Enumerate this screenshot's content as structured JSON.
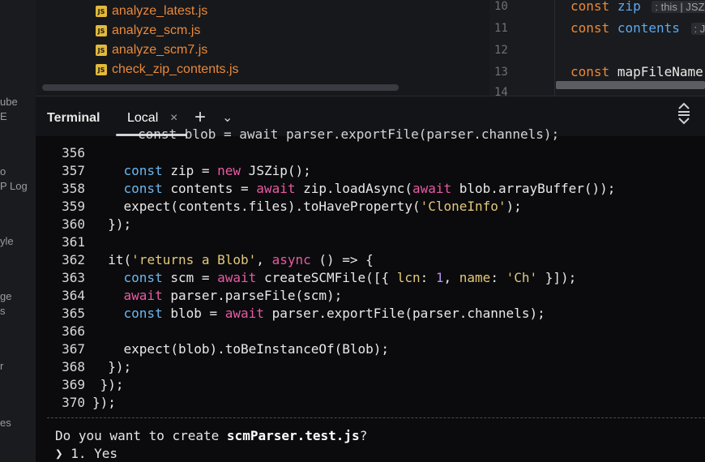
{
  "left_rail": {
    "fragments": [
      "ube",
      "E",
      "o",
      "P Log",
      "yle",
      "ge",
      "s",
      "r",
      "es"
    ]
  },
  "project_files": [
    "analyze_latest.js",
    "analyze_scm.js",
    "analyze_scm7.js",
    "check_zip_contents.js"
  ],
  "editor": {
    "lines": [
      {
        "num": "10",
        "kw": "const",
        "name": "zip",
        "hint": ": this | JSZ"
      },
      {
        "num": "11",
        "kw": "const",
        "name": "contents",
        "hint": ": JS"
      },
      {
        "num": "12",
        "kw": "",
        "name": "",
        "hint": ""
      },
      {
        "num": "13",
        "kw": "const",
        "name": "mapFileName",
        "hint": ""
      },
      {
        "num": "14",
        "kw": "",
        "name": "",
        "hint": ""
      }
    ]
  },
  "terminal_panel": {
    "title": "Terminal",
    "tab_local": "Local",
    "close_glyph": "×",
    "plus_glyph": "+",
    "chevron_glyph": "⌄"
  },
  "terminal": {
    "partial_top_line": "const blob = await parser.exportFile(parser.channels);",
    "lines": [
      {
        "num": "356",
        "segs": []
      },
      {
        "num": "357",
        "segs": [
          [
            "    ",
            "id"
          ],
          [
            "const",
            "dec"
          ],
          [
            " zip = ",
            "id"
          ],
          [
            "new",
            "kw"
          ],
          [
            " JSZip();",
            "id"
          ]
        ]
      },
      {
        "num": "358",
        "segs": [
          [
            "    ",
            "id"
          ],
          [
            "const",
            "dec"
          ],
          [
            " contents = ",
            "id"
          ],
          [
            "await",
            "kw"
          ],
          [
            " zip.loadAsync(",
            "id"
          ],
          [
            "await",
            "kw"
          ],
          [
            " blob.arrayBuffer());",
            "id"
          ]
        ]
      },
      {
        "num": "359",
        "segs": [
          [
            "    expect(contents.files).toHaveProperty(",
            "id"
          ],
          [
            "'CloneInfo'",
            "str"
          ],
          [
            ");",
            "id"
          ]
        ]
      },
      {
        "num": "360",
        "segs": [
          [
            "  });",
            "id"
          ]
        ]
      },
      {
        "num": "361",
        "segs": []
      },
      {
        "num": "362",
        "segs": [
          [
            "  it(",
            "id"
          ],
          [
            "'returns a Blob'",
            "str"
          ],
          [
            ", ",
            "id"
          ],
          [
            "async",
            "kw"
          ],
          [
            " () => {",
            "id"
          ]
        ]
      },
      {
        "num": "363",
        "segs": [
          [
            "    ",
            "id"
          ],
          [
            "const",
            "dec"
          ],
          [
            " scm = ",
            "id"
          ],
          [
            "await",
            "kw"
          ],
          [
            " createSCMFile([{ ",
            "id"
          ],
          [
            "lcn",
            "prop"
          ],
          [
            ": ",
            "id"
          ],
          [
            "1",
            "num"
          ],
          [
            ", ",
            "id"
          ],
          [
            "name",
            "prop"
          ],
          [
            ": ",
            "id"
          ],
          [
            "'Ch'",
            "str"
          ],
          [
            " }]);",
            "id"
          ]
        ]
      },
      {
        "num": "364",
        "segs": [
          [
            "    ",
            "id"
          ],
          [
            "await",
            "kw"
          ],
          [
            " parser.parseFile(scm);",
            "id"
          ]
        ]
      },
      {
        "num": "365",
        "segs": [
          [
            "    ",
            "id"
          ],
          [
            "const",
            "dec"
          ],
          [
            " blob = ",
            "id"
          ],
          [
            "await",
            "kw"
          ],
          [
            " parser.exportFile(parser.channels);",
            "id"
          ]
        ]
      },
      {
        "num": "366",
        "segs": []
      },
      {
        "num": "367",
        "segs": [
          [
            "    expect(blob).toBeInstanceOf(Blob);",
            "id"
          ]
        ]
      },
      {
        "num": "368",
        "segs": [
          [
            "  });",
            "id"
          ]
        ]
      },
      {
        "num": "369",
        "segs": [
          [
            " });",
            "id"
          ]
        ]
      },
      {
        "num": "370",
        "segs": [
          [
            "});",
            "id"
          ]
        ]
      }
    ],
    "prompt_text": "Do you want to create ",
    "prompt_file": "scmParser.test.js",
    "prompt_end": "?",
    "answer": "❯ 1. Yes"
  }
}
